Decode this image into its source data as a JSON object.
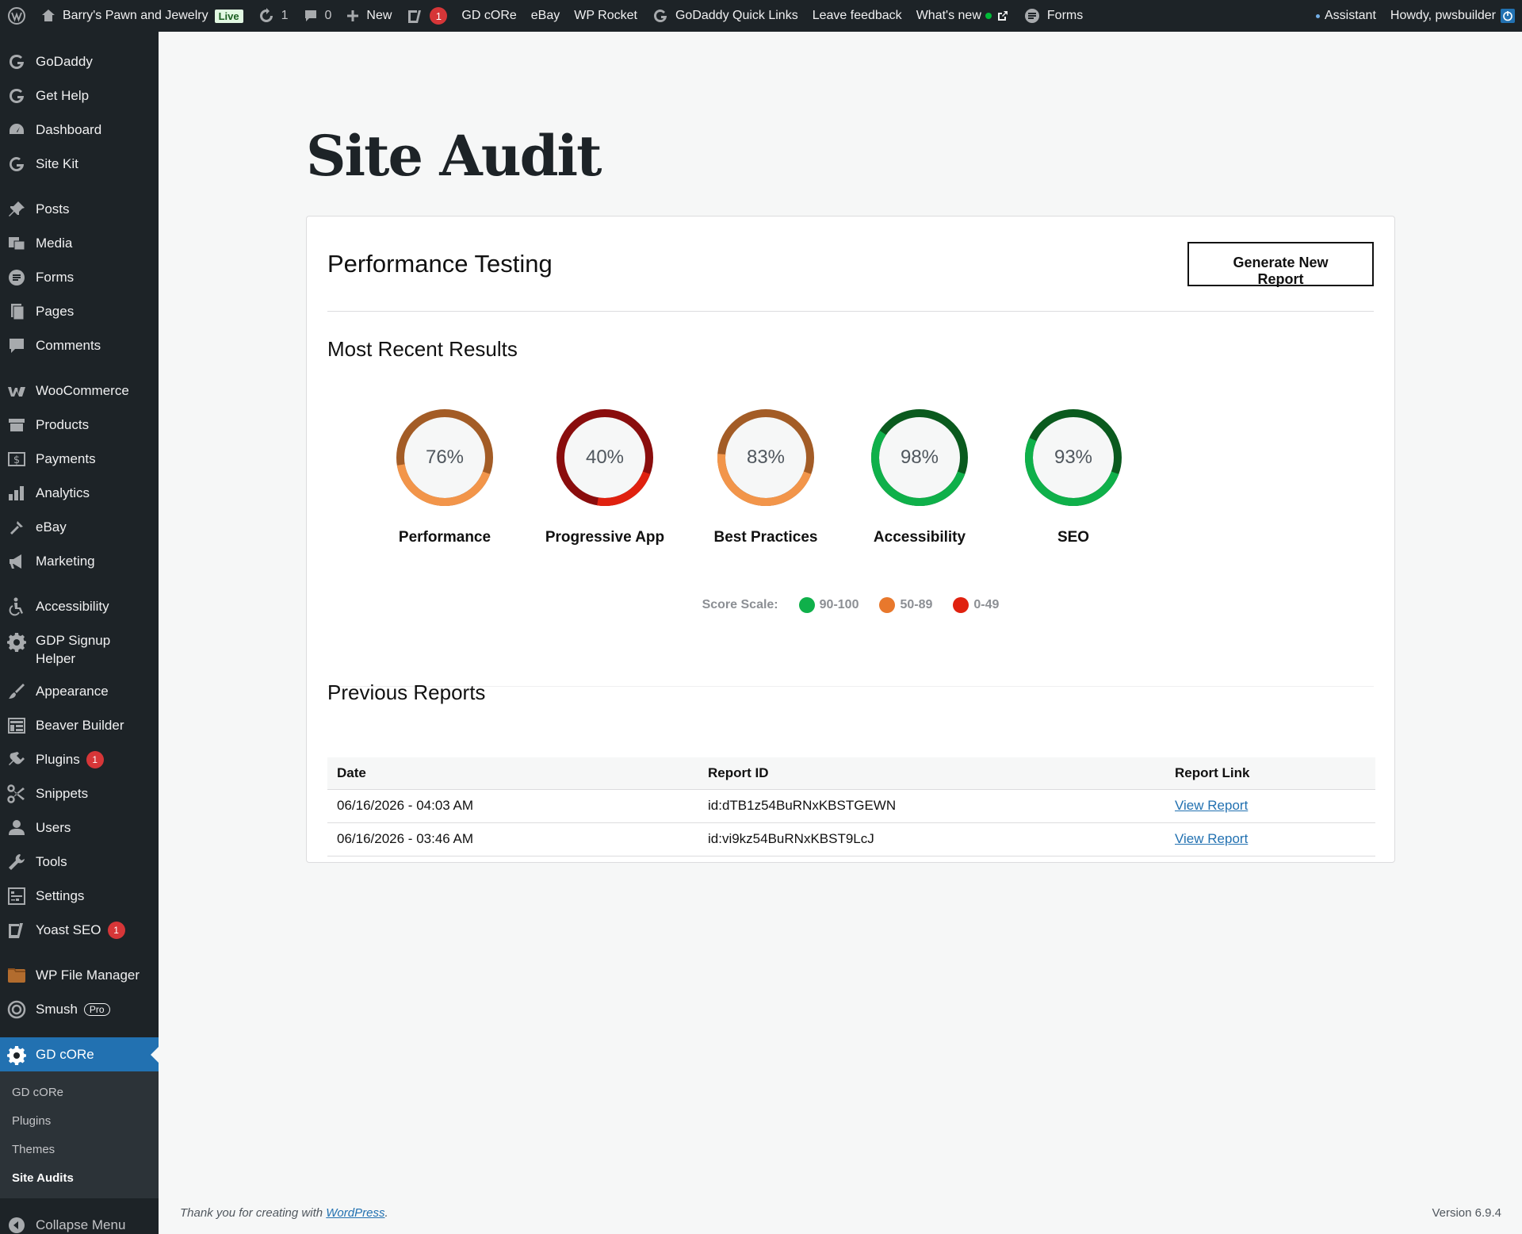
{
  "adminbar": {
    "site_name": "Barry's Pawn and Jewelry",
    "live_label": "Live",
    "updates_count": "1",
    "comments_count": "0",
    "new_label": "New",
    "yoast_count": "1",
    "gd_core": "GD cORe",
    "ebay": "eBay",
    "wp_rocket": "WP Rocket",
    "quick_links": "GoDaddy Quick Links",
    "feedback": "Leave feedback",
    "whats_new": "What's new",
    "forms": "Forms",
    "assistant": "Assistant",
    "howdy": "Howdy, pwsbuilder"
  },
  "sidebar": {
    "items": [
      {
        "label": "GoDaddy",
        "icon": "godaddy-icon"
      },
      {
        "label": "Get Help",
        "icon": "godaddy-icon"
      },
      {
        "label": "Dashboard",
        "icon": "dashboard-icon"
      },
      {
        "label": "Site Kit",
        "icon": "google-icon"
      },
      {
        "label": "Posts",
        "icon": "pin-icon"
      },
      {
        "label": "Media",
        "icon": "media-icon"
      },
      {
        "label": "Forms",
        "icon": "forms-icon"
      },
      {
        "label": "Pages",
        "icon": "pages-icon"
      },
      {
        "label": "Comments",
        "icon": "comment-icon"
      },
      {
        "label": "WooCommerce",
        "icon": "woo-icon"
      },
      {
        "label": "Products",
        "icon": "archive-icon"
      },
      {
        "label": "Payments",
        "icon": "payments-icon"
      },
      {
        "label": "Analytics",
        "icon": "chart-icon"
      },
      {
        "label": "eBay",
        "icon": "ebay-icon"
      },
      {
        "label": "Marketing",
        "icon": "megaphone-icon"
      },
      {
        "label": "Accessibility",
        "icon": "accessibility-icon"
      },
      {
        "label": "GDP Signup Helper",
        "icon": "gear-icon"
      },
      {
        "label": "Appearance",
        "icon": "brush-icon"
      },
      {
        "label": "Beaver Builder",
        "icon": "layout-icon"
      },
      {
        "label": "Plugins",
        "icon": "plugin-icon",
        "badge": "1"
      },
      {
        "label": "Snippets",
        "icon": "scissors-icon"
      },
      {
        "label": "Users",
        "icon": "user-icon"
      },
      {
        "label": "Tools",
        "icon": "wrench-icon"
      },
      {
        "label": "Settings",
        "icon": "settings-icon"
      },
      {
        "label": "Yoast SEO",
        "icon": "yoast-icon",
        "badge": "1"
      },
      {
        "label": "WP File Manager",
        "icon": "file-manager-icon"
      },
      {
        "label": "Smush",
        "icon": "smush-icon",
        "pro": "Pro"
      },
      {
        "label": "GD cORe",
        "icon": "gear-icon"
      }
    ],
    "submenu": [
      "GD cORe",
      "Plugins",
      "Themes",
      "Site Audits"
    ],
    "collapse": "Collapse Menu"
  },
  "page": {
    "title": "Site Audit",
    "card_title": "Performance Testing",
    "generate_button": "Generate New Report",
    "recent_title": "Most Recent Results",
    "previous_title": "Previous Reports"
  },
  "gauges": [
    {
      "label": "Performance",
      "value": 76,
      "display": "76%",
      "dark": "#a35c26",
      "light": "#f2954a"
    },
    {
      "label": "Progressive App",
      "value": 40,
      "display": "40%",
      "dark": "#8a0d0d",
      "light": "#e0210f"
    },
    {
      "label": "Best Practices",
      "value": 83,
      "display": "83%",
      "dark": "#a35c26",
      "light": "#f2954a"
    },
    {
      "label": "Accessibility",
      "value": 98,
      "display": "98%",
      "dark": "#0a5a1e",
      "light": "#0fb04a"
    },
    {
      "label": "SEO",
      "value": 93,
      "display": "93%",
      "dark": "#0a5a1e",
      "light": "#0fb04a"
    }
  ],
  "scale": {
    "label": "Score Scale:",
    "items": [
      {
        "range": "90-100",
        "color": "#0fb04a"
      },
      {
        "range": "50-89",
        "color": "#e8782c"
      },
      {
        "range": "0-49",
        "color": "#e0210f"
      }
    ]
  },
  "table": {
    "headers": [
      "Date",
      "Report ID",
      "Report Link"
    ],
    "rows": [
      {
        "date": "06/16/2026 - 04:03 AM",
        "id": "id:dTB1z54BuRNxKBSTGEWN",
        "link": "View Report"
      },
      {
        "date": "06/16/2026 - 03:46 AM",
        "id": "id:vi9kz54BuRNxKBST9LcJ",
        "link": "View Report"
      }
    ]
  },
  "footer": {
    "thanks": "Thank you for creating with",
    "wp_link": "WordPress",
    "version": "Version 6.9.4"
  }
}
